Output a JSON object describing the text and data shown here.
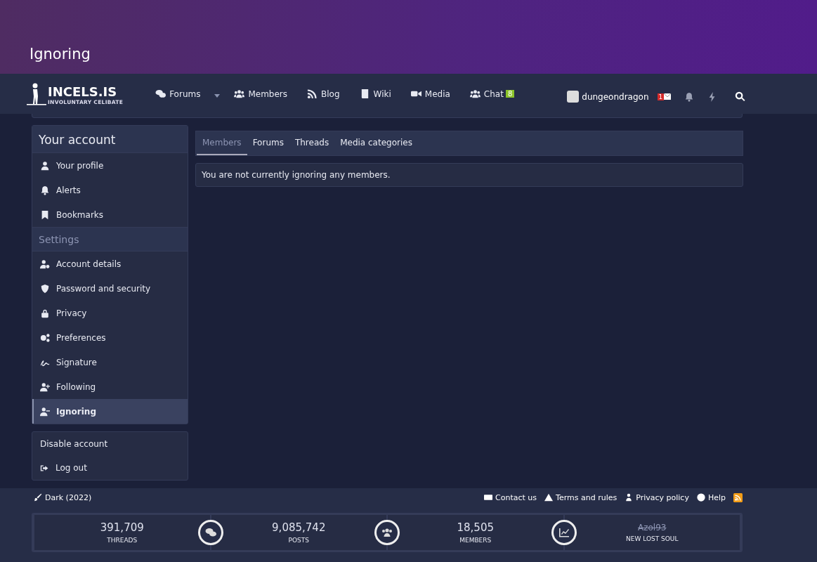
{
  "page_title": "Ignoring",
  "logo": {
    "name": "INCELS.IS",
    "tagline": "INVOLUNTARY CELIBATE"
  },
  "nav": [
    {
      "label": "Forums",
      "dropdown": true
    },
    {
      "label": "Members",
      "dropdown": false
    },
    {
      "label": "Blog",
      "dropdown": false
    },
    {
      "label": "Wiki",
      "dropdown": false
    },
    {
      "label": "Media",
      "dropdown": false
    },
    {
      "label": "Chat",
      "dropdown": false,
      "badge": "8"
    }
  ],
  "user": {
    "name": "dungeondragon",
    "inbox_count": "1"
  },
  "sidebar": {
    "title": "Your account",
    "groups": [
      {
        "items": [
          {
            "label": "Your profile",
            "selected": false
          },
          {
            "label": "Alerts",
            "selected": false
          },
          {
            "label": "Bookmarks",
            "selected": false
          }
        ]
      },
      {
        "heading": "Settings",
        "items": [
          {
            "label": "Account details",
            "selected": false
          },
          {
            "label": "Password and security",
            "selected": false
          },
          {
            "label": "Privacy",
            "selected": false
          },
          {
            "label": "Preferences",
            "selected": false
          },
          {
            "label": "Signature",
            "selected": false
          },
          {
            "label": "Following",
            "selected": false
          },
          {
            "label": "Ignoring",
            "selected": true
          }
        ]
      }
    ],
    "extra": [
      {
        "label": "Disable account",
        "icon": false
      },
      {
        "label": "Log out",
        "icon": true
      }
    ]
  },
  "tabs": [
    {
      "label": "Members",
      "selected": true
    },
    {
      "label": "Forums",
      "selected": false
    },
    {
      "label": "Threads",
      "selected": false
    },
    {
      "label": "Media categories",
      "selected": false
    }
  ],
  "message": "You are not currently ignoring any members.",
  "footer": {
    "style": "Dark (2022)",
    "links": [
      "Contact us",
      "Terms and rules",
      "Privacy policy",
      "Help"
    ]
  },
  "stats": [
    {
      "value": "391,709",
      "label": "THREADS",
      "struck": false
    },
    {
      "value": "9,085,742",
      "label": "POSTS",
      "struck": false
    },
    {
      "value": "18,505",
      "label": "MEMBERS",
      "struck": false
    },
    {
      "value": "Azol93",
      "label": "NEW LOST SOUL",
      "struck": true
    }
  ]
}
